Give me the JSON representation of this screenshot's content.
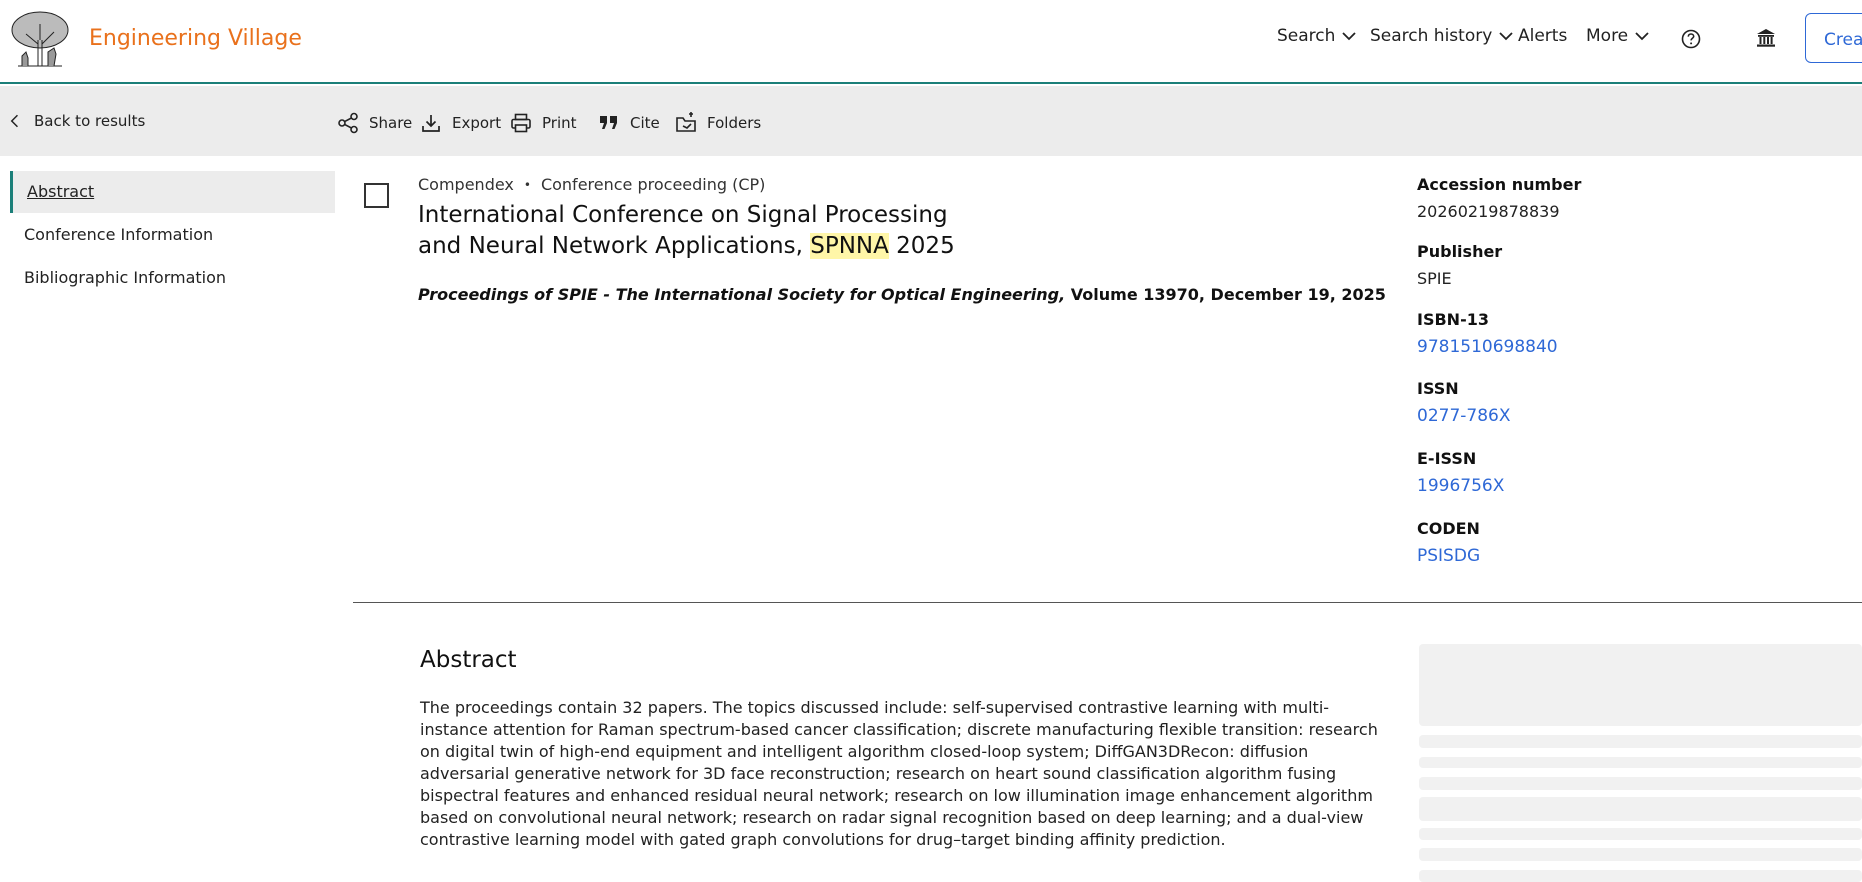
{
  "header": {
    "brand": "Engineering Village",
    "nav": [
      {
        "label": "Search"
      },
      {
        "label": "Search history"
      },
      {
        "label": "Alerts"
      },
      {
        "label": "More"
      }
    ],
    "create_label": "Creat",
    "accent": "#e9711c",
    "line_color": "#1b7f79"
  },
  "toolbar": {
    "back_label": "Back to results",
    "share_label": "Share",
    "export_label": "Export",
    "print_label": "Print",
    "cite_label": "Cite",
    "folders_label": "Folders"
  },
  "sidebar": {
    "items": [
      {
        "label": "Abstract"
      },
      {
        "label": "Conference Information"
      },
      {
        "label": "Bibliographic Information"
      }
    ]
  },
  "record": {
    "database": "Compendex",
    "doc_type": "Conference proceeding (CP)",
    "title_line1": "International Conference on Signal Processing",
    "title_line2_pre": "and Neural Network Applications, ",
    "title_highlight": "SPNNA",
    "title_line2_post": " 2025",
    "source_italic": "Proceedings of SPIE - The International Society for Optical Engineering,",
    "source_rest": " Volume 13970, December 19, 2025"
  },
  "details": {
    "accession_label": "Accession number",
    "accession_value": "20260219878839",
    "publisher_label": "Publisher",
    "publisher_value": "SPIE",
    "isbn_label": "ISBN-13",
    "isbn_value": "9781510698840",
    "issn_label": "ISSN",
    "issn_value": "0277-786X",
    "eissn_label": "E-ISSN",
    "eissn_value": "1996756X",
    "coden_label": "CODEN",
    "coden_value": "PSISDG",
    "link_color": "#2e68d6"
  },
  "abstract": {
    "heading": "Abstract",
    "text": "The proceedings contain 32 papers. The topics discussed include: self-supervised contrastive learning with multi-instance attention for Raman spectrum-based cancer classification; discrete manufacturing flexible transition: research on digital twin of high-end equipment and intelligent algorithm closed-loop system; DiffGAN3DRecon: diffusion adversarial generative network for 3D face reconstruction; research on heart sound classification algorithm fusing bispectral features and enhanced residual neural network; research on low illumination image enhancement algorithm based on convolutional neural network; research on radar signal recognition based on deep learning; and a dual-view contrastive learning model with gated graph convolutions for drug–target binding affinity prediction."
  }
}
